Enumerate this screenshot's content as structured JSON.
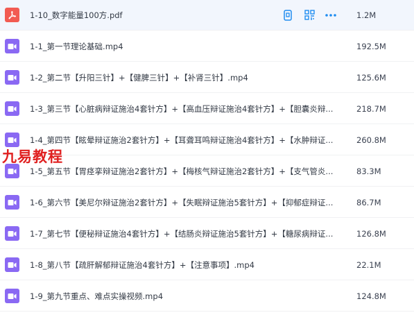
{
  "files": [
    {
      "name": "1-10_数字能量100方.pdf",
      "size": "1.2M",
      "type": "pdf-icon"
    },
    {
      "name": "1-1_第一节理论基础.mp4",
      "size": "192.5M",
      "type": "video-icon"
    },
    {
      "name": "1-2_第二节【升阳三针】+【健脾三针】+【补肾三针】.mp4",
      "size": "125.6M",
      "type": "video-icon"
    },
    {
      "name": "1-3_第三节【心脏病辩证施治4套针方】+【高血压辩证施治4套针方】+【胆囊炎辩...",
      "size": "218.7M",
      "type": "video-icon"
    },
    {
      "name": "1-4_第四节【眩晕辩证施治2套针方】+【耳聋耳鸣辩证施治4套针方】+【水肿辩证...",
      "size": "260.8M",
      "type": "video-icon"
    },
    {
      "name": "1-5_第五节【胃痉挛辩证施治2套针方】+【梅核气辩证施治2套针方】+【支气管炎...",
      "size": "83.3M",
      "type": "video-icon"
    },
    {
      "name": "1-6_第六节【美尼尔辩证施治2套针方】+【失眠辩证施治5套针方】+【抑郁症辩证...",
      "size": "86.7M",
      "type": "video-icon"
    },
    {
      "name": "1-7_第七节【便秘辩证施治4套针方】+【结肠炎辩证施治5套针方】+【糖尿病辩证...",
      "size": "126.8M",
      "type": "video-icon"
    },
    {
      "name": "1-8_第八节【疏肝解郁辩证施治4套针方】+【注意事项】.mp4",
      "size": "22.1M",
      "type": "video-icon"
    },
    {
      "name": "1-9_第九节重点、难点实操视频.mp4",
      "size": "124.8M",
      "type": "video-icon"
    }
  ],
  "actions": [
    "phone-icon",
    "qr-code-icon",
    "more-icon"
  ],
  "watermark": "九易教程",
  "colors": {
    "video": "#8a69f3",
    "pdf": "#f25b52",
    "action": "#1e8cf0",
    "watermark": "#e02020"
  }
}
